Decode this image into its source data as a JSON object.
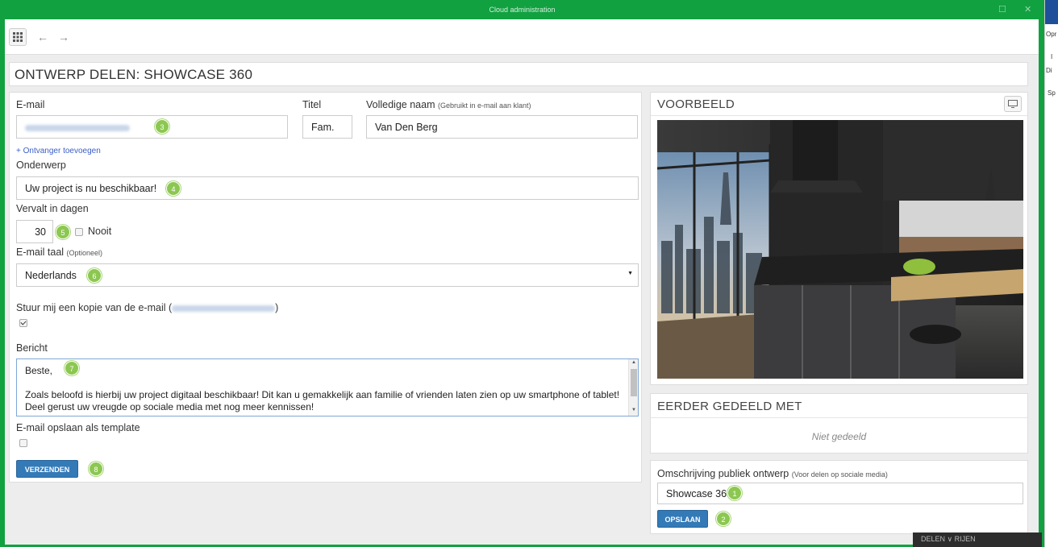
{
  "window": {
    "title": "Cloud administration",
    "controls": [
      "☐",
      "✕"
    ]
  },
  "side_strip": {
    "labels": [
      "Opr",
      "I",
      "Di",
      "Sp"
    ]
  },
  "toolbar": {
    "apps_icon": "grid-icon",
    "back_icon": "←",
    "forward_icon": "→"
  },
  "page": {
    "title": "ONTWERP DELEN: SHOWCASE 360"
  },
  "form": {
    "email": {
      "label": "E-mail"
    },
    "title": {
      "label": "Titel",
      "value": "Fam."
    },
    "fullname": {
      "label": "Volledige naam",
      "hint": "(Gebruikt in e-mail aan klant)",
      "value": "Van Den Berg"
    },
    "add_recipient": "+ Ontvanger toevoegen",
    "subject": {
      "label": "Onderwerp",
      "value": "Uw project is nu beschikbaar!"
    },
    "expires": {
      "label": "Vervalt in dagen",
      "value": "30",
      "never_label": "Nooit",
      "never_checked": false
    },
    "language": {
      "label": "E-mail taal",
      "hint": "(Optioneel)",
      "value": "Nederlands"
    },
    "copy": {
      "label_prefix": "Stuur mij een kopie van de e-mail (",
      "label_suffix": ")",
      "checked": true
    },
    "message": {
      "label": "Bericht",
      "lines": [
        "Beste,",
        "",
        "Zoals beloofd is hierbij uw project digitaal beschikbaar! Dit kan u gemakkelijk aan familie of vrienden laten zien op uw smartphone of tablet!",
        "Deel gerust uw vreugde op sociale media met nog meer kennissen!"
      ]
    },
    "save_template": {
      "label": "E-mail opslaan als template",
      "checked": false
    },
    "send_button": "VERZENDEN"
  },
  "preview": {
    "heading": "VOORBEELD",
    "monitor_icon": "monitor-icon"
  },
  "shared": {
    "heading": "EERDER GEDEELD MET",
    "empty": "Niet gedeeld"
  },
  "public": {
    "label": "Omschrijving publiek ontwerp",
    "hint": "(Voor delen op sociale media)",
    "value": "Showcase 360",
    "save_button": "OPSLAAN"
  },
  "badges": {
    "public_desc": "1",
    "save": "2",
    "email": "3",
    "subject": "4",
    "expires": "5",
    "language": "6",
    "message": "7",
    "send": "8"
  },
  "bottom_overlay": "DELEN ∨ RIJEN"
}
